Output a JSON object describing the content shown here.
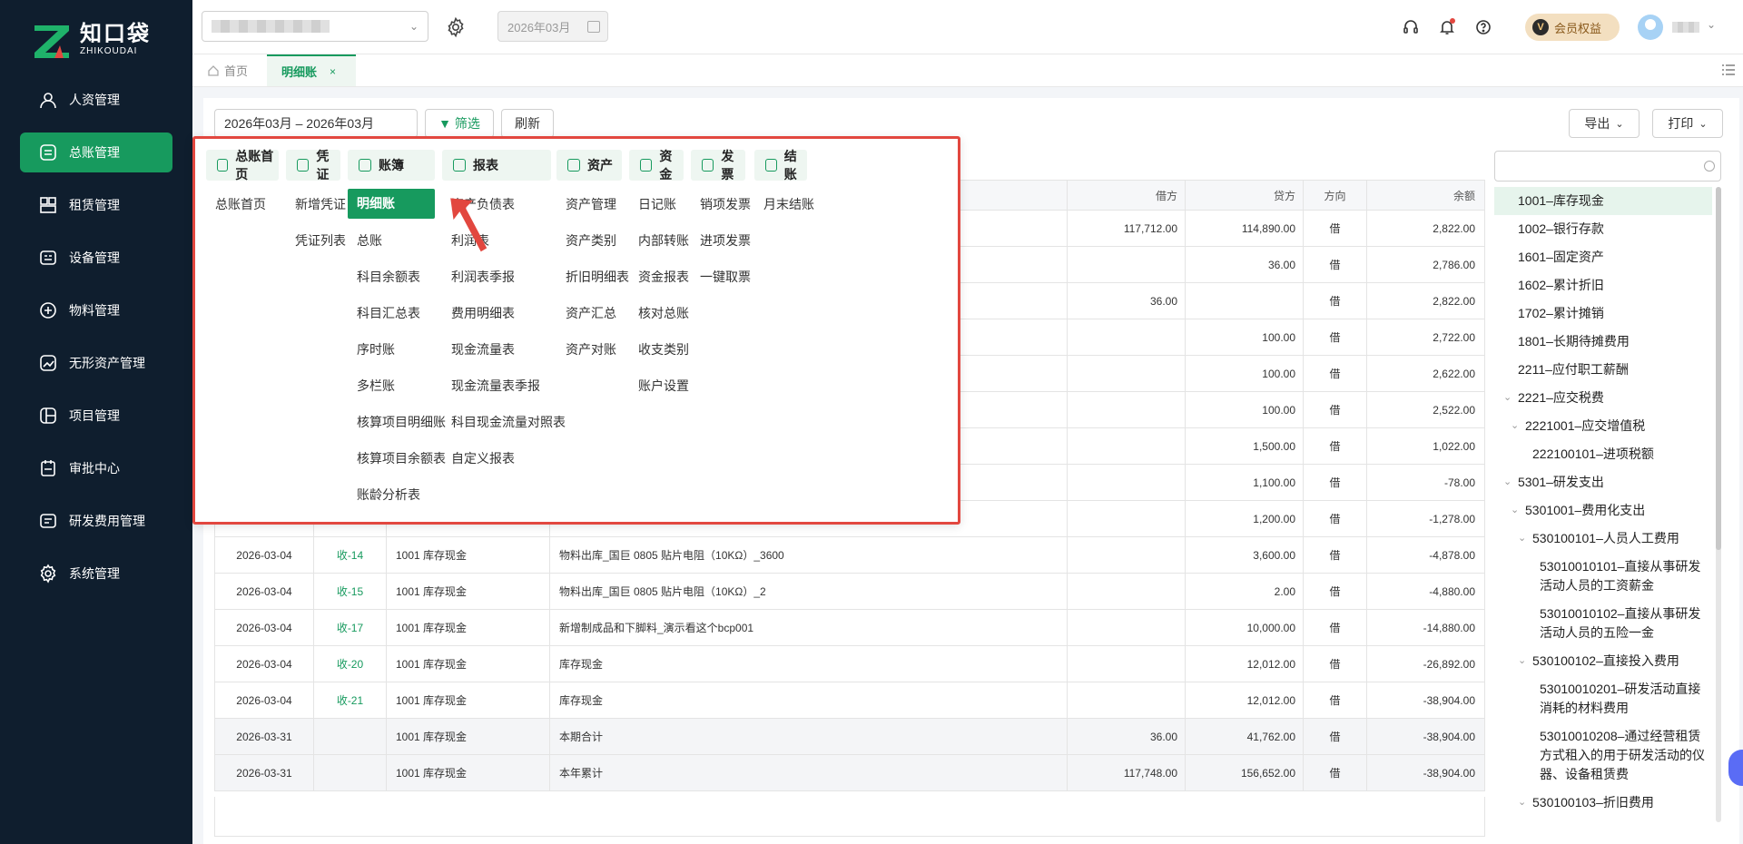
{
  "app": {
    "logo_cn": "知口袋",
    "logo_en": "ZHIKOUDAI",
    "accent": "#179a5e",
    "sidebar_bg": "#0f1e2e"
  },
  "sidebar": {
    "items": [
      {
        "label": "人资管理",
        "icon": "person-icon"
      },
      {
        "label": "总账管理",
        "icon": "ledger-icon",
        "active": true
      },
      {
        "label": "租赁管理",
        "icon": "lease-icon"
      },
      {
        "label": "设备管理",
        "icon": "device-icon"
      },
      {
        "label": "物料管理",
        "icon": "material-icon"
      },
      {
        "label": "无形资产管理",
        "icon": "intangible-icon"
      },
      {
        "label": "项目管理",
        "icon": "project-icon"
      },
      {
        "label": "审批中心",
        "icon": "approval-icon"
      },
      {
        "label": "研发费用管理",
        "icon": "rd-icon"
      },
      {
        "label": "系统管理",
        "icon": "gear-icon"
      }
    ]
  },
  "topbar": {
    "period": "2026年03月",
    "member_label": "会员权益",
    "member_badge": "V"
  },
  "tabs": {
    "home": "首页",
    "active": "明细账",
    "close": "×"
  },
  "toolbar": {
    "date_range": "2026年03月 – 2026年03月",
    "filter": "筛选",
    "refresh": "刷新",
    "export": "导出",
    "print": "打印"
  },
  "table": {
    "headers": {
      "debit": "借方",
      "credit": "贷方",
      "direction": "方向",
      "balance": "余额"
    },
    "rows": [
      {
        "date": "",
        "no": "",
        "account": "",
        "summary": "",
        "debit": "117,712.00",
        "credit": "114,890.00",
        "dir": "借",
        "balance": "2,822.00"
      },
      {
        "date": "",
        "no": "",
        "account": "",
        "summary": "",
        "debit": "",
        "credit": "36.00",
        "dir": "借",
        "balance": "2,786.00"
      },
      {
        "date": "",
        "no": "",
        "account": "",
        "summary": "",
        "debit": "36.00",
        "credit": "",
        "dir": "借",
        "balance": "2,822.00"
      },
      {
        "date": "",
        "no": "",
        "account": "",
        "summary": "",
        "debit": "",
        "credit": "100.00",
        "dir": "借",
        "balance": "2,722.00"
      },
      {
        "date": "",
        "no": "",
        "account": "",
        "summary": "",
        "debit": "",
        "credit": "100.00",
        "dir": "借",
        "balance": "2,622.00"
      },
      {
        "date": "",
        "no": "",
        "account": "",
        "summary": "",
        "debit": "",
        "credit": "100.00",
        "dir": "借",
        "balance": "2,522.00"
      },
      {
        "date": "",
        "no": "",
        "account": "",
        "summary": "",
        "debit": "",
        "credit": "1,500.00",
        "dir": "借",
        "balance": "1,022.00"
      },
      {
        "date": "",
        "no": "",
        "account": "",
        "summary": "",
        "debit": "",
        "credit": "1,100.00",
        "dir": "借",
        "balance": "-78.00"
      },
      {
        "date": "",
        "no": "",
        "account": "",
        "summary": "",
        "debit": "",
        "credit": "1,200.00",
        "dir": "借",
        "balance": "-1,278.00"
      },
      {
        "date": "2026-03-04",
        "no": "收-14",
        "account": "1001 库存现金",
        "summary": "物料出库_国巨 0805 贴片电阻（10KΩ）_3600",
        "debit": "",
        "credit": "3,600.00",
        "dir": "借",
        "balance": "-4,878.00"
      },
      {
        "date": "2026-03-04",
        "no": "收-15",
        "account": "1001 库存现金",
        "summary": "物料出库_国巨 0805 贴片电阻（10KΩ）_2",
        "debit": "",
        "credit": "2.00",
        "dir": "借",
        "balance": "-4,880.00"
      },
      {
        "date": "2026-03-04",
        "no": "收-17",
        "account": "1001 库存现金",
        "summary": "新增制成品和下脚料_演示看这个bcp001",
        "debit": "",
        "credit": "10,000.00",
        "dir": "借",
        "balance": "-14,880.00"
      },
      {
        "date": "2026-03-04",
        "no": "收-20",
        "account": "1001 库存现金",
        "summary": "库存现金",
        "debit": "",
        "credit": "12,012.00",
        "dir": "借",
        "balance": "-26,892.00"
      },
      {
        "date": "2026-03-04",
        "no": "收-21",
        "account": "1001 库存现金",
        "summary": "库存现金",
        "debit": "",
        "credit": "12,012.00",
        "dir": "借",
        "balance": "-38,904.00"
      },
      {
        "date": "2026-03-31",
        "no": "",
        "account": "1001 库存现金",
        "summary": "本期合计",
        "debit": "36.00",
        "credit": "41,762.00",
        "dir": "借",
        "balance": "-38,904.00",
        "total": true
      },
      {
        "date": "2026-03-31",
        "no": "",
        "account": "1001 库存现金",
        "summary": "本年累计",
        "debit": "117,748.00",
        "credit": "156,652.00",
        "dir": "借",
        "balance": "-38,904.00",
        "total": true
      }
    ]
  },
  "tree": {
    "items": [
      {
        "label": "1001–库存现金",
        "level": 0,
        "selected": true
      },
      {
        "label": "1002–银行存款",
        "level": 0
      },
      {
        "label": "1601–固定资产",
        "level": 0
      },
      {
        "label": "1602–累计折旧",
        "level": 0
      },
      {
        "label": "1702–累计摊销",
        "level": 0
      },
      {
        "label": "1801–长期待摊费用",
        "level": 0
      },
      {
        "label": "2211–应付职工薪酬",
        "level": 0
      },
      {
        "label": "2221–应交税费",
        "level": 0,
        "caret": "⌄"
      },
      {
        "label": "2221001–应交增值税",
        "level": 1,
        "caret": "⌄"
      },
      {
        "label": "222100101–进项税额",
        "level": 2
      },
      {
        "label": "5301–研发支出",
        "level": 0,
        "caret": "⌄"
      },
      {
        "label": "5301001–费用化支出",
        "level": 1,
        "caret": "⌄"
      },
      {
        "label": "530100101–人员人工费用",
        "level": 2,
        "caret": "⌄"
      },
      {
        "label": "53010010101–直接从事研发活动人员的工资薪金",
        "level": 3
      },
      {
        "label": "53010010102–直接从事研发活动人员的五险一金",
        "level": 3
      },
      {
        "label": "530100102–直接投入费用",
        "level": 2,
        "caret": "⌄"
      },
      {
        "label": "53010010201–研发活动直接消耗的材料费用",
        "level": 3
      },
      {
        "label": "53010010208–通过经营租赁方式租入的用于研发活动的仪器、设备租赁费",
        "level": 3
      },
      {
        "label": "530100103–折旧费用",
        "level": 2,
        "caret": "⌄"
      }
    ]
  },
  "mega": {
    "columns": [
      {
        "title": "总账首页",
        "links": [
          "总账首页"
        ]
      },
      {
        "title": "凭证",
        "links": [
          "新增凭证",
          "凭证列表"
        ]
      },
      {
        "title": "账簿",
        "links": [
          "明细账",
          "总账",
          "科目余额表",
          "科目汇总表",
          "序时账",
          "多栏账",
          "核算项目明细账",
          "核算项目余额表",
          "账龄分析表"
        ],
        "active": 0
      },
      {
        "title": "报表",
        "links": [
          "资产负债表",
          "利润表",
          "利润表季报",
          "费用明细表",
          "现金流量表",
          "现金流量表季报",
          "科目现金流量对照表",
          "自定义报表"
        ]
      },
      {
        "title": "资产",
        "links": [
          "资产管理",
          "资产类别",
          "折旧明细表",
          "资产汇总",
          "资产对账"
        ]
      },
      {
        "title": "资金",
        "links": [
          "日记账",
          "内部转账",
          "资金报表",
          "核对总账",
          "收支类别",
          "账户设置"
        ]
      },
      {
        "title": "发票",
        "links": [
          "销项发票",
          "进项发票",
          "一键取票"
        ]
      },
      {
        "title": "结账",
        "links": [
          "月末结账"
        ]
      }
    ]
  }
}
